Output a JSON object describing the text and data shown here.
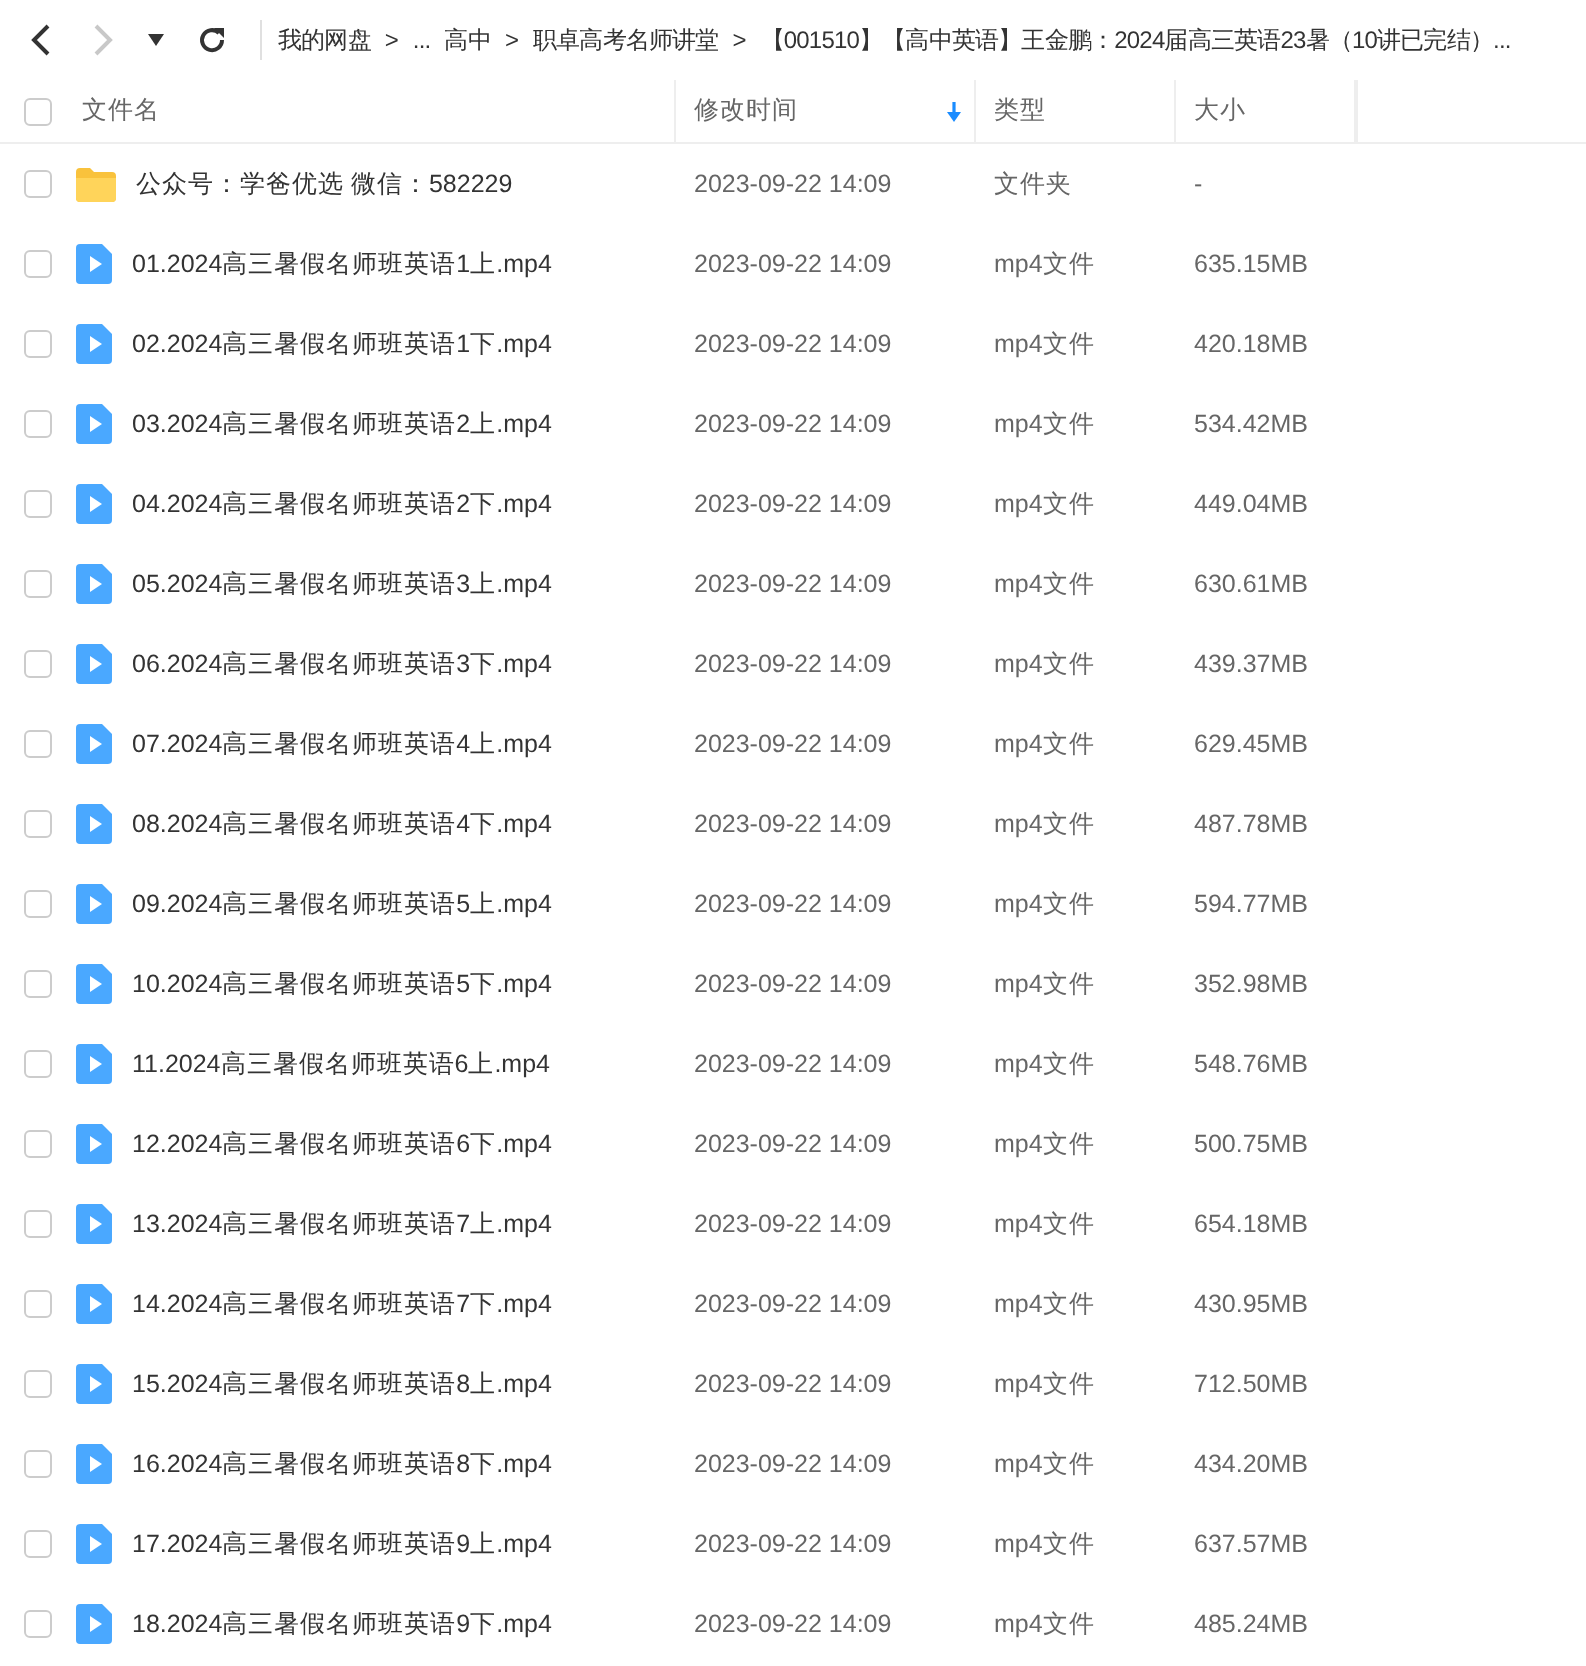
{
  "breadcrumb": [
    {
      "kind": "crumb",
      "text": "我的网盘"
    },
    {
      "kind": "sep",
      "text": ">"
    },
    {
      "kind": "crumb",
      "text": "..."
    },
    {
      "kind": "crumb",
      "text": "高中"
    },
    {
      "kind": "sep",
      "text": ">"
    },
    {
      "kind": "crumb",
      "text": "职卓高考名师讲堂"
    },
    {
      "kind": "sep",
      "text": ">"
    },
    {
      "kind": "crumb",
      "text": "【001510】【高中英语】王金鹏：2024届高三英语23暑（10讲已完结）..."
    }
  ],
  "nav": {
    "back_disabled": false,
    "forward_disabled": true
  },
  "table": {
    "columns": [
      {
        "label": "文件名",
        "sorted": false
      },
      {
        "label": "修改时间",
        "sorted": true
      },
      {
        "label": "类型",
        "sorted": false
      },
      {
        "label": "大小",
        "sorted": false
      }
    ],
    "all_checked": false,
    "rows": [
      {
        "kind": "folder",
        "name": "公众号：学爸优选 微信：582229",
        "date": "2023-09-22 14:09",
        "type": "文件夹",
        "size": "-",
        "checked": false
      },
      {
        "kind": "video",
        "name": "01.2024高三暑假名师班英语1上.mp4",
        "date": "2023-09-22 14:09",
        "type": "mp4文件",
        "size": "635.15MB",
        "checked": false
      },
      {
        "kind": "video",
        "name": "02.2024高三暑假名师班英语1下.mp4",
        "date": "2023-09-22 14:09",
        "type": "mp4文件",
        "size": "420.18MB",
        "checked": false
      },
      {
        "kind": "video",
        "name": "03.2024高三暑假名师班英语2上.mp4",
        "date": "2023-09-22 14:09",
        "type": "mp4文件",
        "size": "534.42MB",
        "checked": false
      },
      {
        "kind": "video",
        "name": "04.2024高三暑假名师班英语2下.mp4",
        "date": "2023-09-22 14:09",
        "type": "mp4文件",
        "size": "449.04MB",
        "checked": false
      },
      {
        "kind": "video",
        "name": "05.2024高三暑假名师班英语3上.mp4",
        "date": "2023-09-22 14:09",
        "type": "mp4文件",
        "size": "630.61MB",
        "checked": false
      },
      {
        "kind": "video",
        "name": "06.2024高三暑假名师班英语3下.mp4",
        "date": "2023-09-22 14:09",
        "type": "mp4文件",
        "size": "439.37MB",
        "checked": false
      },
      {
        "kind": "video",
        "name": "07.2024高三暑假名师班英语4上.mp4",
        "date": "2023-09-22 14:09",
        "type": "mp4文件",
        "size": "629.45MB",
        "checked": false
      },
      {
        "kind": "video",
        "name": "08.2024高三暑假名师班英语4下.mp4",
        "date": "2023-09-22 14:09",
        "type": "mp4文件",
        "size": "487.78MB",
        "checked": false
      },
      {
        "kind": "video",
        "name": "09.2024高三暑假名师班英语5上.mp4",
        "date": "2023-09-22 14:09",
        "type": "mp4文件",
        "size": "594.77MB",
        "checked": false
      },
      {
        "kind": "video",
        "name": "10.2024高三暑假名师班英语5下.mp4",
        "date": "2023-09-22 14:09",
        "type": "mp4文件",
        "size": "352.98MB",
        "checked": false
      },
      {
        "kind": "video",
        "name": "11.2024高三暑假名师班英语6上.mp4",
        "date": "2023-09-22 14:09",
        "type": "mp4文件",
        "size": "548.76MB",
        "checked": false
      },
      {
        "kind": "video",
        "name": "12.2024高三暑假名师班英语6下.mp4",
        "date": "2023-09-22 14:09",
        "type": "mp4文件",
        "size": "500.75MB",
        "checked": false
      },
      {
        "kind": "video",
        "name": "13.2024高三暑假名师班英语7上.mp4",
        "date": "2023-09-22 14:09",
        "type": "mp4文件",
        "size": "654.18MB",
        "checked": false
      },
      {
        "kind": "video",
        "name": "14.2024高三暑假名师班英语7下.mp4",
        "date": "2023-09-22 14:09",
        "type": "mp4文件",
        "size": "430.95MB",
        "checked": false
      },
      {
        "kind": "video",
        "name": "15.2024高三暑假名师班英语8上.mp4",
        "date": "2023-09-22 14:09",
        "type": "mp4文件",
        "size": "712.50MB",
        "checked": false
      },
      {
        "kind": "video",
        "name": "16.2024高三暑假名师班英语8下.mp4",
        "date": "2023-09-22 14:09",
        "type": "mp4文件",
        "size": "434.20MB",
        "checked": false
      },
      {
        "kind": "video",
        "name": "17.2024高三暑假名师班英语9上.mp4",
        "date": "2023-09-22 14:09",
        "type": "mp4文件",
        "size": "637.57MB",
        "checked": false
      },
      {
        "kind": "video",
        "name": "18.2024高三暑假名师班英语9下.mp4",
        "date": "2023-09-22 14:09",
        "type": "mp4文件",
        "size": "485.24MB",
        "checked": false
      }
    ]
  }
}
